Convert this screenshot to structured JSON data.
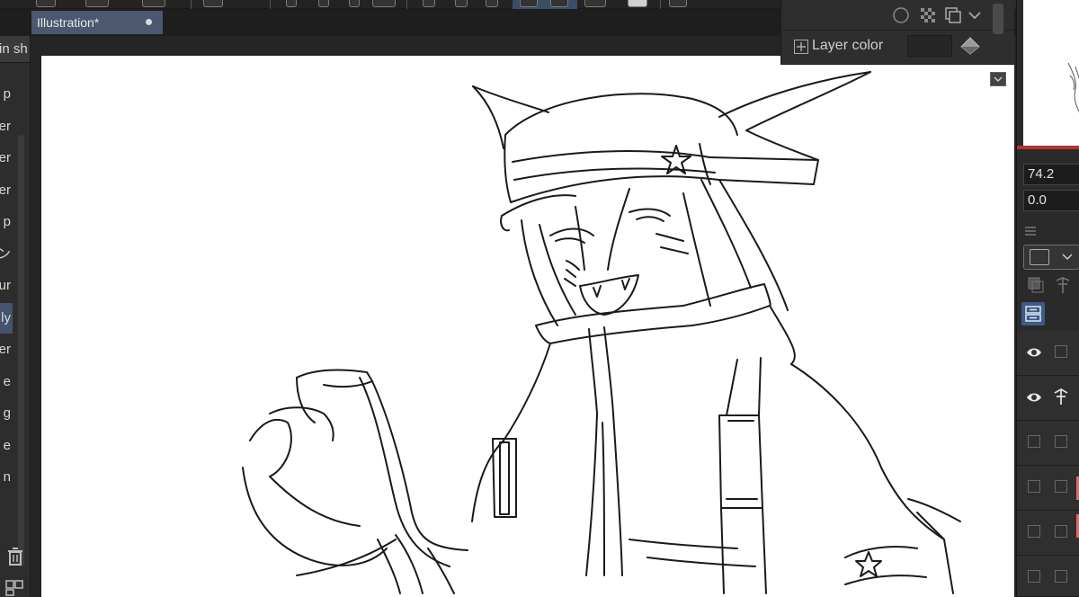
{
  "document": {
    "tab_title": "Illustration*"
  },
  "left_panel": {
    "header": "in sh",
    "brushes": [
      {
        "label": "p",
        "selected": false
      },
      {
        "label": "er",
        "selected": false
      },
      {
        "label": "er",
        "selected": false
      },
      {
        "label": "er",
        "selected": false
      },
      {
        "label": "p",
        "selected": false
      },
      {
        "label": "ン",
        "selected": false
      },
      {
        "label": "ur",
        "selected": false
      },
      {
        "label": "ly",
        "selected": true
      },
      {
        "label": "er",
        "selected": false
      },
      {
        "label": "e",
        "selected": false
      },
      {
        "label": "g",
        "selected": false
      },
      {
        "label": "e",
        "selected": false
      },
      {
        "label": "n",
        "selected": false
      }
    ]
  },
  "layer_property": {
    "layer_color_label": "Layer color"
  },
  "right_panel": {
    "opacity_value": "74.2",
    "offset_value": "0.0"
  },
  "colors": {
    "tab_active": "#4b5870",
    "selection": "#44546d",
    "accent_red": "#b53030",
    "layer_marker": "#e06a6a",
    "active_tool": "#3f5a86"
  },
  "icons": [
    "trash-icon",
    "eye-icon",
    "ruler-icon",
    "lock-icon",
    "layer-list-icon",
    "circle-icon",
    "checker-icon",
    "copy-icon",
    "chevron-down-icon",
    "fill-icon"
  ]
}
